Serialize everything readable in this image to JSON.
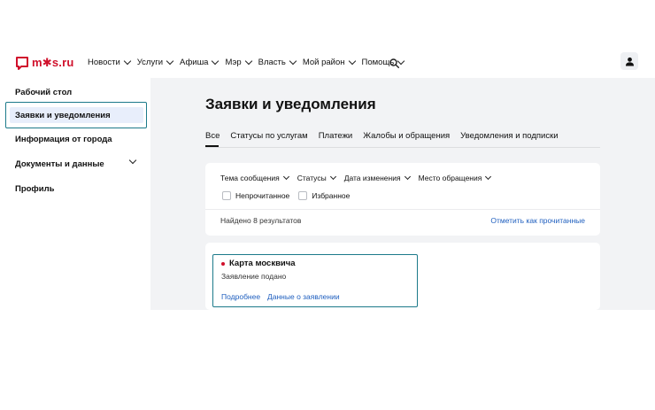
{
  "header": {
    "logo_text": "m✱s.ru",
    "nav": [
      {
        "label": "Новости",
        "has_dropdown": true
      },
      {
        "label": "Услуги",
        "has_dropdown": true
      },
      {
        "label": "Афиша",
        "has_dropdown": true
      },
      {
        "label": "Мэр",
        "has_dropdown": true
      },
      {
        "label": "Власть",
        "has_dropdown": true
      },
      {
        "label": "Мой район",
        "has_dropdown": true
      },
      {
        "label": "Помощь",
        "has_dropdown": true
      }
    ],
    "search_icon": "search-icon",
    "profile_icon": "user-icon"
  },
  "sidebar": {
    "items": [
      {
        "label": "Рабочий стол"
      },
      {
        "label": "Заявки и уведомления",
        "active": true
      },
      {
        "label": "Информация от города"
      },
      {
        "label": "Документы и данные",
        "has_dropdown": true
      },
      {
        "label": "Профиль"
      }
    ]
  },
  "main": {
    "title": "Заявки и уведомления",
    "tabs": [
      {
        "label": "Все",
        "active": true
      },
      {
        "label": "Статусы по услугам"
      },
      {
        "label": "Платежи"
      },
      {
        "label": "Жалобы и обращения"
      },
      {
        "label": "Уведомления и подписки"
      }
    ],
    "filters": [
      {
        "label": "Тема сообщения"
      },
      {
        "label": "Статусы"
      },
      {
        "label": "Дата изменения"
      },
      {
        "label": "Место обращения"
      }
    ],
    "checkboxes": [
      {
        "label": "Непрочитанное",
        "checked": false
      },
      {
        "label": "Избранное",
        "checked": false
      }
    ],
    "found_text": "Найдено 8 результатов",
    "mark_read": "Отметить как прочитанные",
    "results": [
      {
        "title": "Карта москвича",
        "status": "Заявление подано",
        "link_more": "Подробнее",
        "link_data": "Данные о заявлении",
        "unread": true
      }
    ]
  },
  "colors": {
    "brand_red": "#d0102b",
    "link_blue": "#1f5fbf",
    "highlight_outline": "#1c7a8a",
    "active_fill": "#e8eefb",
    "main_bg": "#f2f3f5"
  }
}
